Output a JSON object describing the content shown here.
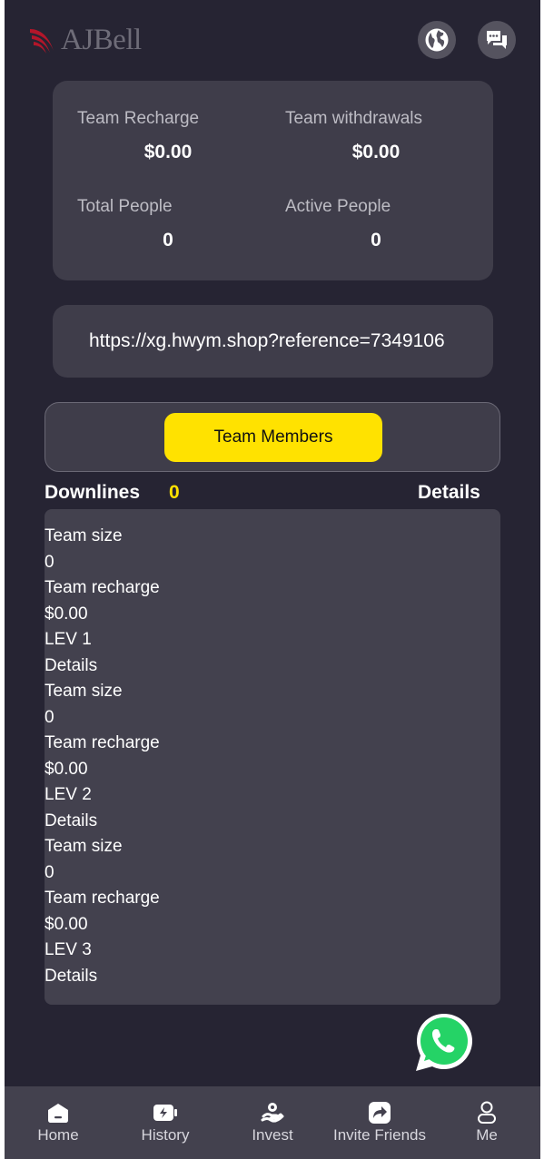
{
  "header": {
    "brand": "AJBell"
  },
  "stats": {
    "team_recharge": {
      "label": "Team Recharge",
      "value": "$0.00"
    },
    "team_withdrawals": {
      "label": "Team withdrawals",
      "value": "$0.00"
    },
    "total_people": {
      "label": "Total People",
      "value": "0"
    },
    "active_people": {
      "label": "Active People",
      "value": "0"
    }
  },
  "referral": {
    "url": "https://xg.hwym.shop?reference=7349106"
  },
  "team_button": {
    "label": "Team Members"
  },
  "downlines": {
    "title": "Downlines",
    "count": "0",
    "details_label": "Details"
  },
  "levels": [
    {
      "size_label": "Team size",
      "size": "0",
      "recharge_label": "Team recharge",
      "recharge": "$0.00",
      "level": "LEV 1",
      "details": "Details"
    },
    {
      "size_label": "Team size",
      "size": "0",
      "recharge_label": "Team recharge",
      "recharge": "$0.00",
      "level": "LEV 2",
      "details": "Details"
    },
    {
      "size_label": "Team size",
      "size": "0",
      "recharge_label": "Team recharge",
      "recharge": "$0.00",
      "level": "LEV 3",
      "details": "Details"
    }
  ],
  "nav": [
    {
      "label": "Home",
      "icon": "home-icon"
    },
    {
      "label": "History",
      "icon": "history-icon"
    },
    {
      "label": "Invest",
      "icon": "invest-icon"
    },
    {
      "label": "Invite Friends",
      "icon": "share-icon"
    },
    {
      "label": "Me",
      "icon": "user-icon"
    }
  ],
  "colors": {
    "background": "#262433",
    "card": "#3f3d4a",
    "accent": "#ffe200",
    "whatsapp": "#25d366"
  }
}
